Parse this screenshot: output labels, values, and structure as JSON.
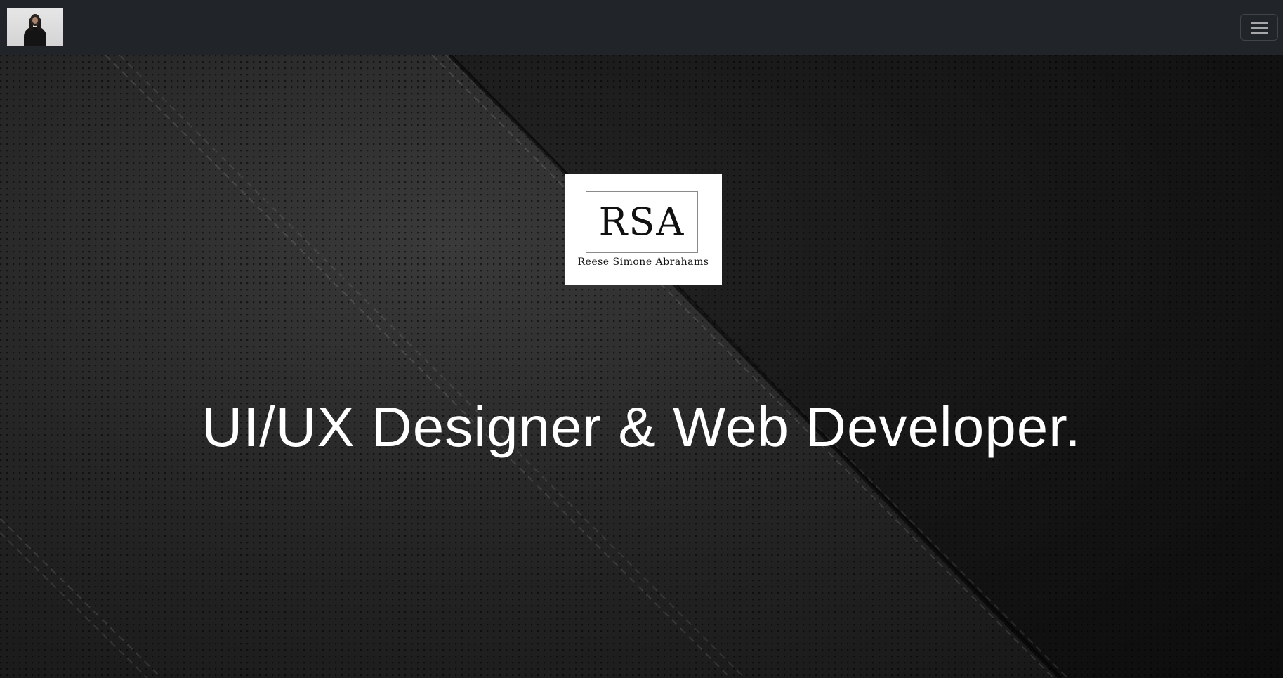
{
  "navbar": {
    "avatar_alt": "Profile photo",
    "menu_icon": "hamburger-menu-icon"
  },
  "hero": {
    "logo": {
      "mark": "RSA",
      "name": "Reese Simone Abrahams"
    },
    "headline": "UI/UX Designer & Web Developer."
  },
  "colors": {
    "navbar_bg": "#212529",
    "hero_text": "#ffffff",
    "logo_bg": "#ffffff"
  }
}
